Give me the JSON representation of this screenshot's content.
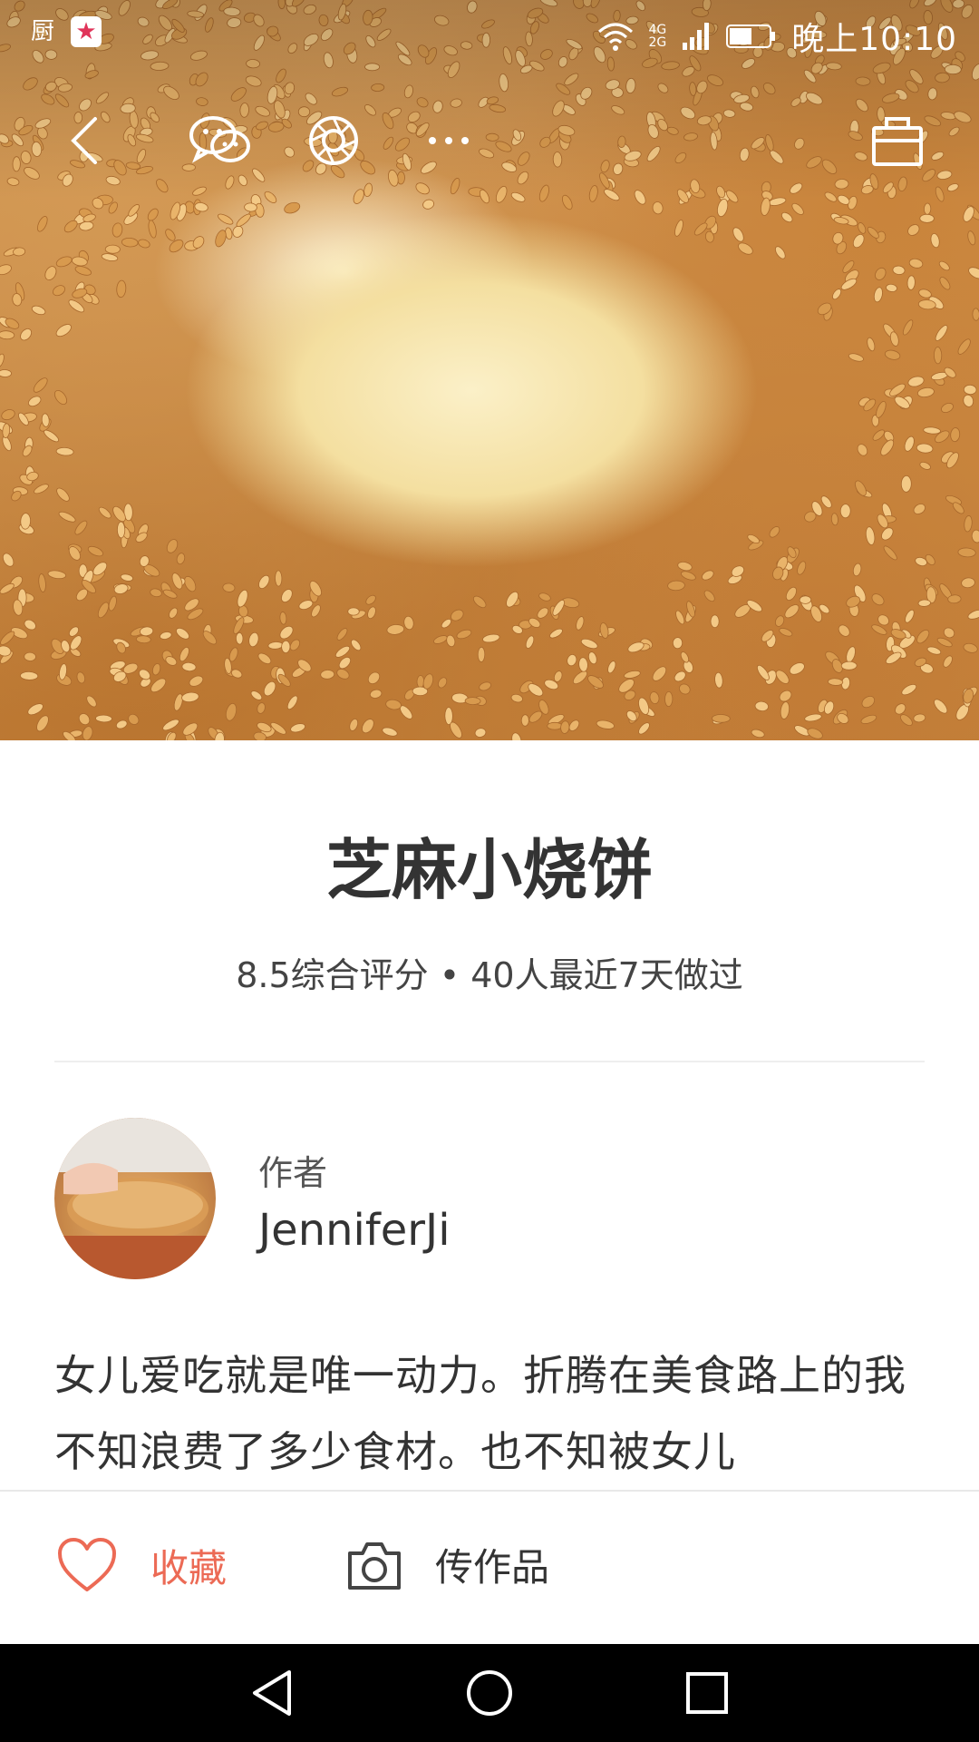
{
  "status_bar": {
    "app_icon_1": "厨",
    "app_icon_2": "★",
    "network": "4G 2G",
    "time": "晚上10:10"
  },
  "toolbar": {
    "back_icon": "chevron-left-icon",
    "wechat_icon": "wechat-icon",
    "moments_icon": "moments-icon",
    "more_icon": "more-icon",
    "basket_icon": "basket-icon"
  },
  "recipe": {
    "title": "芝麻小烧饼",
    "meta": "8.5综合评分 • 40人最近7天做过",
    "author_label": "作者",
    "author_name": "JenniferJi",
    "description": "女儿爱吃就是唯一动力。折腾在美食路上的我不知浪费了多少食材。也不知被女儿"
  },
  "actions": {
    "favorite_label": "收藏",
    "upload_label": "传作品"
  },
  "colors": {
    "accent": "#ec6a55",
    "text": "#333333",
    "navbar": "#000000"
  }
}
